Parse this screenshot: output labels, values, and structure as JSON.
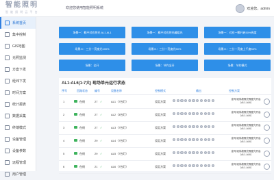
{
  "app": {
    "logo_text": "智能照明",
    "logo_sub": "智 能 照 明 云 平 台",
    "system_title": "欢迎您使用智能照明系统",
    "user_text": "欢迎您，admin"
  },
  "sidebar": {
    "items": [
      {
        "label": "系统首页",
        "icon": "home-icon",
        "active": true
      },
      {
        "label": "集中控制",
        "icon": "control-icon",
        "active": false
      },
      {
        "label": "GIS地图",
        "icon": "map-icon",
        "active": false
      },
      {
        "label": "光照监测",
        "icon": "light-icon",
        "active": false
      },
      {
        "label": "方案下发",
        "icon": "plan-icon",
        "active": false
      },
      {
        "label": "经纬下发",
        "icon": "gps-icon",
        "active": false
      },
      {
        "label": "时间方案",
        "icon": "clock-icon",
        "active": false
      },
      {
        "label": "统计报表",
        "icon": "report-icon",
        "active": false
      },
      {
        "label": "数据采集",
        "icon": "data-icon",
        "active": false
      },
      {
        "label": "终端模式",
        "icon": "terminal-icon",
        "active": false
      },
      {
        "label": "设备管理",
        "icon": "device-icon",
        "active": false
      },
      {
        "label": "设备参数",
        "icon": "param-icon",
        "active": false
      },
      {
        "label": "远程管理",
        "icon": "remote-icon",
        "active": false
      },
      {
        "label": "用户管理",
        "icon": "user-icon",
        "active": false
      }
    ]
  },
  "tiles": [
    "场景一：概不对应控光 AL1 AL1",
    "场景一：概不对应控光编组光",
    "场景一：对应一颗开启50%亮度",
    "场景二：三分一亮度光100%",
    "场景二：三分一亮度光50%",
    "场景二：三分一亮度上千度50%",
    "场景：全开",
    "场景：节约全开",
    "场景：节约模式"
  ],
  "table": {
    "title": "AL1-AL6(1-7大) 现场单元运行状态",
    "headers": [
      "序号",
      "回路状态",
      "编号",
      "设备名称",
      "控制模式",
      "输出",
      "控制方案"
    ],
    "rows": [
      {
        "no": "1",
        "status": "在线",
        "id": "27",
        "name": "AL1（7台灯）",
        "mode": "设定方案",
        "ctrl": "定时/经纬按照光照度光开启（AL1-AL6）"
      },
      {
        "no": "2",
        "status": "在线",
        "id": "27",
        "name": "AL2（3台灯）",
        "mode": "设定方案",
        "ctrl": "定时/经纬按照光照度光开启（AL1-AL6）"
      },
      {
        "no": "3",
        "status": "在线",
        "id": "27",
        "name": "AL3（7台灯）",
        "mode": "设定方案",
        "ctrl": "定时/经纬按照光照度光开启（AL1-AL6）"
      },
      {
        "no": "4",
        "status": "在线",
        "id": "29",
        "name": "AL4（7台灯）",
        "mode": "设定方案",
        "ctrl": "定时/经纬按照光照度光开启（AL1-AL6）"
      },
      {
        "no": "5",
        "status": "在线",
        "id": "29",
        "name": "AL5（7台灯）",
        "mode": "设定方案",
        "ctrl": "定时/经纬按照光照度光开启（AL1-AL6）"
      },
      {
        "no": "6",
        "status": "在线",
        "id": "21",
        "name": "AL6（7台灯）",
        "mode": "设定方案",
        "ctrl": "定时/经纬按照光照度光开启（AL1-AL6）"
      }
    ]
  },
  "colors": {
    "tile": "#2e8fe8",
    "online": "#3db35c",
    "accent": "#2f7fe0"
  }
}
